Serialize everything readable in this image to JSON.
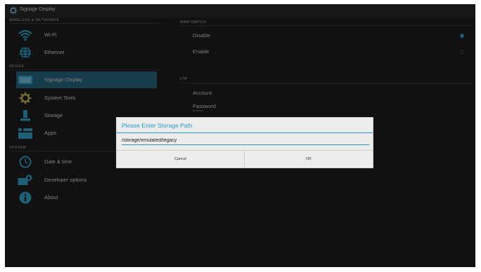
{
  "title": "Signage Display",
  "sidebar": {
    "categories": [
      "WIRELESS & NETWORKS",
      "DEVICE",
      "SYSTEM"
    ],
    "items": [
      {
        "label": "Wi-Fi",
        "icon": "wifi-icon"
      },
      {
        "label": "Ethernet",
        "icon": "ethernet-icon"
      },
      {
        "label": "Signage Display",
        "icon": "display-icon",
        "selected": true
      },
      {
        "label": "System Tools",
        "icon": "gear-icon"
      },
      {
        "label": "Storage",
        "icon": "storage-icon"
      },
      {
        "label": "Apps",
        "icon": "apps-icon"
      },
      {
        "label": "Date & time",
        "icon": "clock-icon"
      },
      {
        "label": "Developer options",
        "icon": "developer-gear-icon"
      },
      {
        "label": "About",
        "icon": "info-icon"
      }
    ]
  },
  "main": {
    "main_switch_header": "MAIN SWITCH",
    "switch_options": [
      {
        "label": "Disable",
        "selected": true
      },
      {
        "label": "Enable",
        "selected": false
      }
    ],
    "ftp_header": "FTP",
    "account_label": "Account",
    "password_label": "Password",
    "password_value": "********"
  },
  "dialog": {
    "title": "Please Enter Storage Path",
    "input_value": "/storage/emulated/legacy",
    "cancel_label": "Cancel",
    "ok_label": "OK"
  },
  "colors": {
    "accent": "#2a9bd0",
    "selected_item_bg": "#2a6f8a",
    "background": "#1f1f1f"
  }
}
